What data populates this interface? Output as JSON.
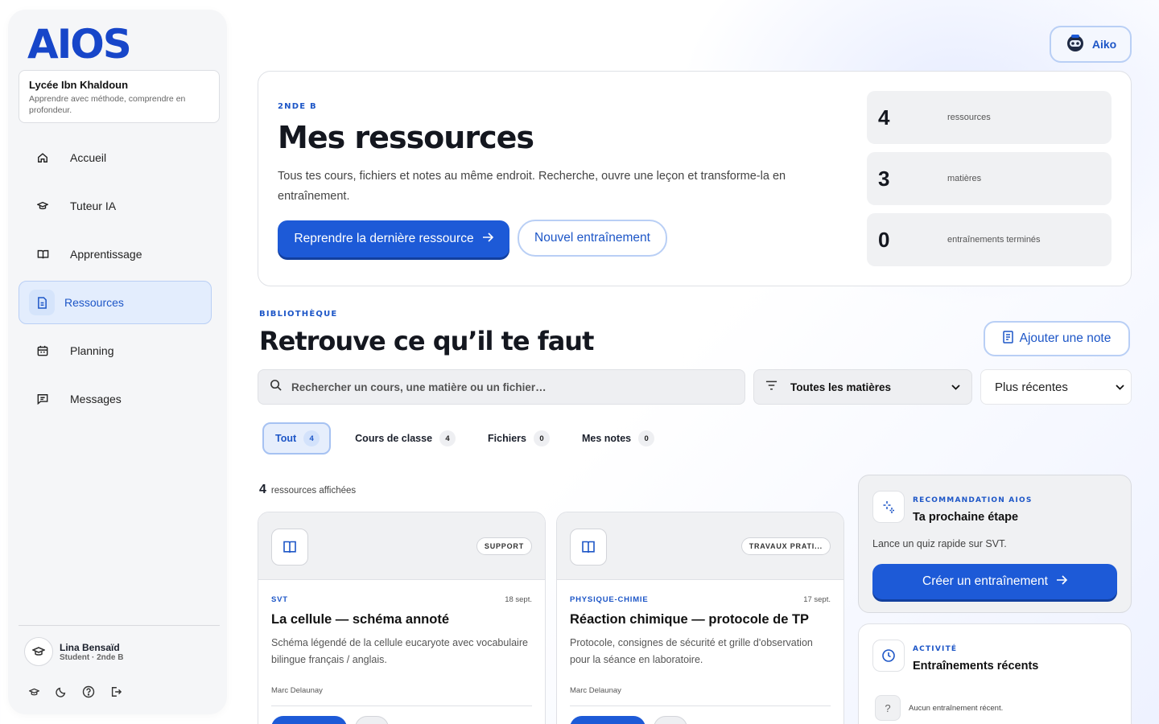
{
  "app": {
    "logo": "AIOS"
  },
  "school": {
    "name": "Lycée Ibn Khaldoun",
    "tagline": "Apprendre avec méthode, comprendre en profondeur."
  },
  "nav": [
    {
      "label": "Accueil",
      "icon": "home-icon"
    },
    {
      "label": "Tuteur IA",
      "icon": "graduation-cap-icon"
    },
    {
      "label": "Apprentissage",
      "icon": "book-open-icon"
    },
    {
      "label": "Ressources",
      "icon": "document-icon",
      "active": true
    },
    {
      "label": "Planning",
      "icon": "calendar-icon"
    },
    {
      "label": "Messages",
      "icon": "message-icon"
    }
  ],
  "user": {
    "name": "Lina Bensaïd",
    "role": "Student · 2nde B"
  },
  "aiko": {
    "label": "Aiko"
  },
  "hero": {
    "eyebrow": "2NDE B",
    "title": "Mes ressources",
    "description": "Tous tes cours, fichiers et notes au même endroit. Recherche, ouvre une leçon et transforme-la en entraînement.",
    "primary_label": "Reprendre la dernière ressource",
    "secondary_label": "Nouvel entraînement",
    "stats": [
      {
        "value": "4",
        "label": "ressources"
      },
      {
        "value": "3",
        "label": "matières"
      },
      {
        "value": "0",
        "label": "entraînements terminés"
      }
    ]
  },
  "library": {
    "eyebrow": "BIBLIOTHÈQUE",
    "title": "Retrouve ce qu’il te faut",
    "add_note_label": "Ajouter une note",
    "search_placeholder": "Rechercher un cours, une matière ou un fichier…",
    "subject_filter": "Toutes les matières",
    "sort": "Plus récentes",
    "tabs": [
      {
        "label": "Tout",
        "count": "4",
        "active": true
      },
      {
        "label": "Cours de classe",
        "count": "4"
      },
      {
        "label": "Fichiers",
        "count": "0"
      },
      {
        "label": "Mes notes",
        "count": "0"
      }
    ],
    "count": "4",
    "count_label": "ressources affichées"
  },
  "resources": [
    {
      "tag": "SUPPORT",
      "subject": "SVT",
      "date": "18 sept.",
      "title": "La cellule — schéma annoté",
      "description": "Schéma légendé de la cellule eucaryote avec vocabulaire bilingue français / anglais.",
      "author": "Marc Delaunay"
    },
    {
      "tag": "TRAVAUX PRATI...",
      "subject": "PHYSIQUE-CHIMIE",
      "date": "17 sept.",
      "title": "Réaction chimique — protocole de TP",
      "description": "Protocole, consignes de sécurité et grille d'observation pour la séance en laboratoire.",
      "author": "Marc Delaunay"
    }
  ],
  "recommendation": {
    "eyebrow": "RECOMMANDATION AIOS",
    "title": "Ta prochaine étape",
    "text": "Lance un quiz rapide sur SVT.",
    "button_label": "Créer un entraînement"
  },
  "activity": {
    "eyebrow": "ACTIVITÉ",
    "title": "Entraînements récents",
    "empty_text": "Aucun entraînement récent.",
    "empty_icon": "?"
  },
  "colors": {
    "accent": "#1d5ad7",
    "accent_light": "#e3edfd",
    "border": "#dfe1e6"
  }
}
